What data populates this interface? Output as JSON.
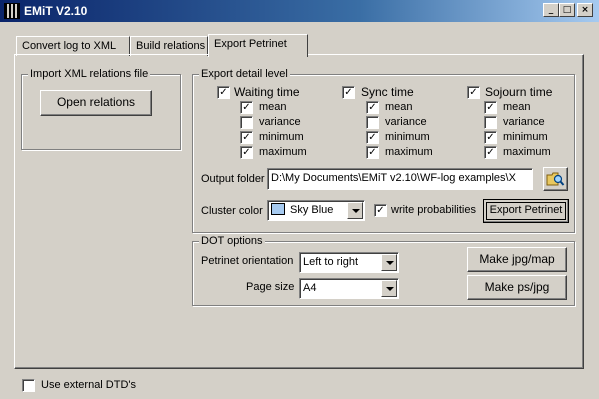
{
  "window": {
    "title": "EMiT V2.10",
    "minimize": "_",
    "maximize": "□",
    "close": "×"
  },
  "tabs": [
    {
      "label": "Convert log to XML"
    },
    {
      "label": "Build relations"
    },
    {
      "label": "Export Petrinet"
    }
  ],
  "import_group": {
    "legend": "Import XML relations file",
    "open_button": "Open relations"
  },
  "export_group": {
    "legend": "Export detail level",
    "columns": [
      {
        "title": "Waiting time",
        "checked": "✓",
        "items": [
          {
            "label": "mean",
            "mark": "✓"
          },
          {
            "label": "variance",
            "mark": ""
          },
          {
            "label": "minimum",
            "mark": "✓"
          },
          {
            "label": "maximum",
            "mark": "✓"
          }
        ]
      },
      {
        "title": "Sync time",
        "checked": "✓",
        "items": [
          {
            "label": "mean",
            "mark": "✓"
          },
          {
            "label": "variance",
            "mark": ""
          },
          {
            "label": "minimum",
            "mark": "✓"
          },
          {
            "label": "maximum",
            "mark": "✓"
          }
        ]
      },
      {
        "title": "Sojourn time",
        "checked": "✓",
        "items": [
          {
            "label": "mean",
            "mark": "✓"
          },
          {
            "label": "variance",
            "mark": ""
          },
          {
            "label": "minimum",
            "mark": "✓"
          },
          {
            "label": "maximum",
            "mark": "✓"
          }
        ]
      }
    ],
    "output_folder_label": "Output folder",
    "output_folder_value": "D:\\My Documents\\EMiT v2.10\\WF-log examples\\X",
    "cluster_color_label": "Cluster color",
    "cluster_color_value": "Sky Blue",
    "cluster_color_hex": "#a6caf0",
    "write_probabilities_label": "write probabilities",
    "write_probabilities_mark": "✓",
    "export_button": "Export Petrinet"
  },
  "dot_group": {
    "legend": "DOT options",
    "orientation_label": "Petrinet orientation",
    "orientation_value": "Left to right",
    "page_size_label": "Page size",
    "page_size_value": "A4",
    "make_jpg_map": "Make jpg/map",
    "make_ps_jpg": "Make ps/jpg"
  },
  "footer": {
    "external_dtd_label": "Use external DTD's",
    "external_dtd_mark": ""
  }
}
